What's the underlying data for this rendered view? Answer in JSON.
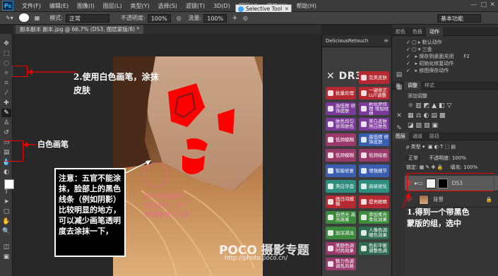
{
  "menubar": {
    "items": [
      "文件(F)",
      "编辑(E)",
      "图像(I)",
      "图层(L)",
      "类型(Y)",
      "选择(S)",
      "滤镜(T)",
      "3D(D)",
      "视图(V)",
      "窗口(W)",
      "帮助(H)"
    ],
    "logo": "Ps"
  },
  "options": {
    "mode_label": "模式:",
    "mode_value": "正常",
    "opacity_label": "不透明度:",
    "opacity_value": "100%",
    "flow_label": "流量:",
    "flow_value": "100%",
    "workspace": "基本功能"
  },
  "selective_tool": {
    "title": "Selective Tool"
  },
  "document": {
    "tab_title": "副本副本 副本.jpg @ 66.7% (DS3, 图层蒙版/8) *"
  },
  "delicious_panel": {
    "title": "DeliciousRetouch",
    "logo": "DR3",
    "buttons": [
      {
        "label": "完美皮肤",
        "color": "red"
      },
      {
        "label": "批量处理",
        "color": "red"
      },
      {
        "label": "一键修正 LUT调整",
        "color": "red"
      },
      {
        "label": "高低频 修饰皮肤",
        "color": "purple"
      },
      {
        "label": "新皮肤纹理 增加纹理",
        "color": "purple"
      },
      {
        "label": "肤色均匀 修饰肤色",
        "color": "purple"
      },
      {
        "label": "美白皮肤 亮白肤色",
        "color": "purple"
      },
      {
        "label": "低频模糊",
        "color": "pink"
      },
      {
        "label": "高低频 修饰皮肤",
        "color": "blue"
      },
      {
        "label": "低频模糊",
        "color": "pink"
      },
      {
        "label": "低频绘画",
        "color": "pink"
      },
      {
        "label": "智能修复",
        "color": "blue"
      },
      {
        "label": "增强细节",
        "color": "blue"
      },
      {
        "label": "美白牙齿",
        "color": "teal"
      },
      {
        "label": "高级锐化",
        "color": "teal"
      },
      {
        "label": "画日间模糊",
        "color": "red"
      },
      {
        "label": "提亮眼睛",
        "color": "red"
      },
      {
        "label": "自然光 高光效果",
        "color": "green"
      },
      {
        "label": "添加柔光 柔化效果",
        "color": "green"
      },
      {
        "label": "加深减淡",
        "color": "green"
      },
      {
        "label": "人像色调 暖色效果",
        "color": "dgreen"
      },
      {
        "label": "美颜色调 时尚效果",
        "color": "pink"
      },
      {
        "label": "色彩平衡 调整色调",
        "color": "dgreen"
      },
      {
        "label": "魅力色调 调色风格",
        "color": "pink"
      }
    ]
  },
  "right_panels": {
    "top_tabs": [
      "颜色",
      "色板",
      "动作"
    ],
    "actions": [
      "默认动作",
      "三金",
      "保存到桌面关闭",
      "初始化修复动作",
      "修图保存动作"
    ],
    "actions_shortcut": "F2",
    "adjust_tabs": [
      "库",
      "调整",
      "样式"
    ],
    "adjust_hint": "添加调整",
    "layer_tabs": [
      "图层",
      "通道",
      "路径"
    ],
    "kind_label": "类型",
    "blend_mode": "正常",
    "opacity_label": "不透明度:",
    "opacity_value": "100%",
    "lock_label": "锁定:",
    "fill_label": "填充:",
    "fill_value": "100%",
    "layers": [
      {
        "name": "DS3",
        "selected": true
      },
      {
        "name": "背景",
        "selected": false
      }
    ]
  },
  "annotations": {
    "step2": "2.使用白色画笔，涂抹",
    "step2_line2": "皮肤",
    "white_brush": "白色画笔",
    "note": "注意：五官不能涂抹，脸部上的黑色线条（例如阴影）比较明显的地方，可以减少画笔透明度去涂抹一下，",
    "pink_line1": "这个地方比较",
    "pink_line2": "比较明显，修",
    "pink_line3": "透明度进行涂抹",
    "step1": "1.得到一个带黑色",
    "step1_line2": "蒙版的组，选中"
  },
  "watermark": {
    "brand": "POCO 摄影专题",
    "url": "http://photo.poco.cn/"
  }
}
